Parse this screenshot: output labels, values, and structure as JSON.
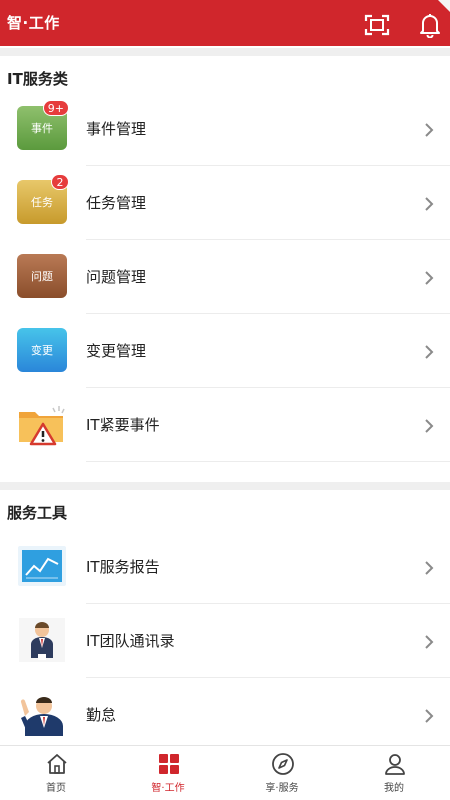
{
  "header": {
    "title": "智·工作",
    "scan_icon": "scan-icon",
    "bell_icon": "bell-icon"
  },
  "sections": [
    {
      "title": "IT服务类"
    },
    {
      "title": "服务工具"
    }
  ],
  "it_services": [
    {
      "label": "事件管理",
      "tile_text": "事件",
      "badge": "9+",
      "icon": "event-tile-icon"
    },
    {
      "label": "任务管理",
      "tile_text": "任务",
      "badge": "2",
      "icon": "task-tile-icon"
    },
    {
      "label": "问题管理",
      "tile_text": "问题",
      "icon": "problem-tile-icon"
    },
    {
      "label": "变更管理",
      "tile_text": "变更",
      "icon": "change-tile-icon"
    },
    {
      "label": "IT紧要事件",
      "icon": "warning-folder-icon"
    }
  ],
  "tools": [
    {
      "label": "IT服务报告",
      "icon": "chart-report-icon"
    },
    {
      "label": "IT团队通讯录",
      "icon": "contact-person-icon"
    },
    {
      "label": "勤怠",
      "icon": "waving-person-icon"
    }
  ],
  "tabbar": [
    {
      "label": "首页",
      "icon": "home-icon"
    },
    {
      "label": "智·工作",
      "icon": "grid-icon",
      "active": true
    },
    {
      "label": "享·服务",
      "icon": "compass-icon"
    },
    {
      "label": "我的",
      "icon": "user-icon"
    }
  ],
  "colors": {
    "brand": "#d0262c",
    "badge": "#e63c3c",
    "divider": "#ececec"
  }
}
